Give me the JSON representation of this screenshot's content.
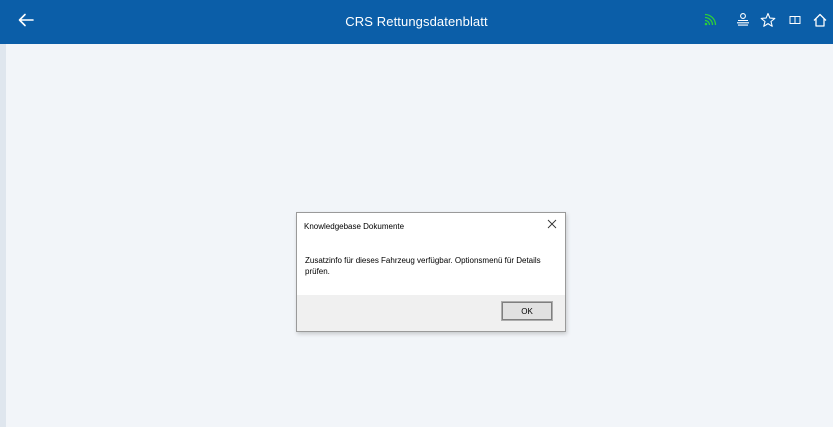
{
  "header": {
    "title": "CRS Rettungsdatenblatt",
    "background_color": "#0b5ea8",
    "icons": {
      "back": "arrow-left-icon",
      "signal": "signal-icon",
      "signal_color": "#2ecf3a",
      "list": "list-icon",
      "favorite": "star-icon",
      "book": "book-icon",
      "home": "home-icon"
    }
  },
  "dialog": {
    "title": "Knowledgebase Dokumente",
    "message": "Zusatzinfo für dieses Fahrzeug verfügbar. Optionsmenü für Details prüfen.",
    "ok_label": "OK",
    "close_icon": "close-icon"
  }
}
